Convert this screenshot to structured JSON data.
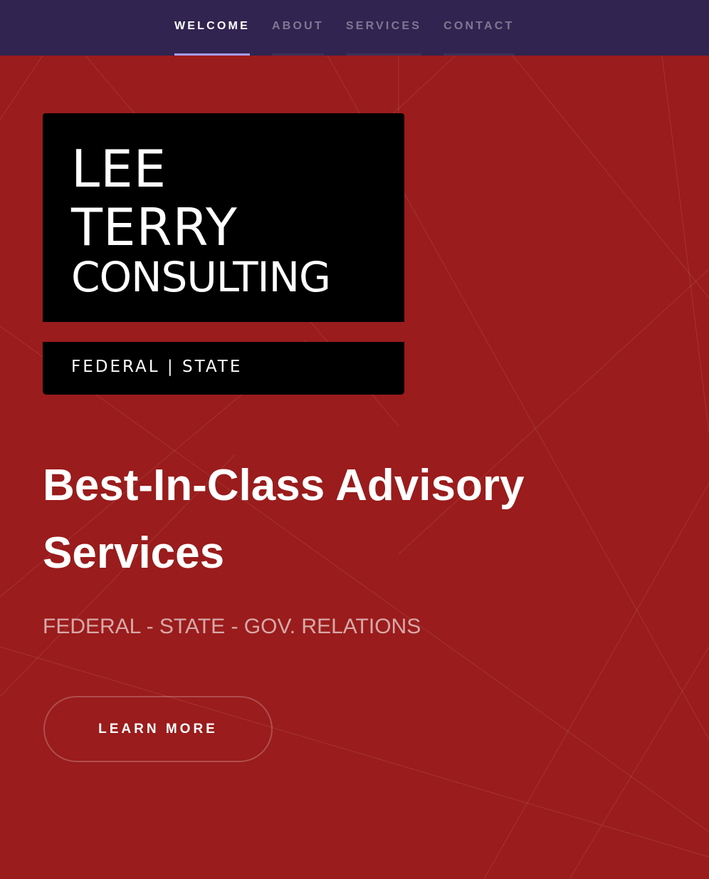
{
  "nav": {
    "items": [
      {
        "label": "WELCOME",
        "active": true
      },
      {
        "label": "ABOUT",
        "active": false
      },
      {
        "label": "SERVICES",
        "active": false
      },
      {
        "label": "CONTACT",
        "active": false
      }
    ]
  },
  "logo": {
    "line1": "LEE",
    "line2": "TERRY",
    "line3": "CONSULTING",
    "tagline": "FEDERAL | STATE"
  },
  "hero": {
    "headline": "Best-In-Class Advisory Services",
    "subtitle": "FEDERAL - STATE - GOV. RELATIONS",
    "cta_label": "LEARN MORE"
  },
  "colors": {
    "nav_background": "#312450",
    "hero_background": "#9a1c1c",
    "active_underline": "#a99cf0",
    "logo_background": "#000000"
  }
}
